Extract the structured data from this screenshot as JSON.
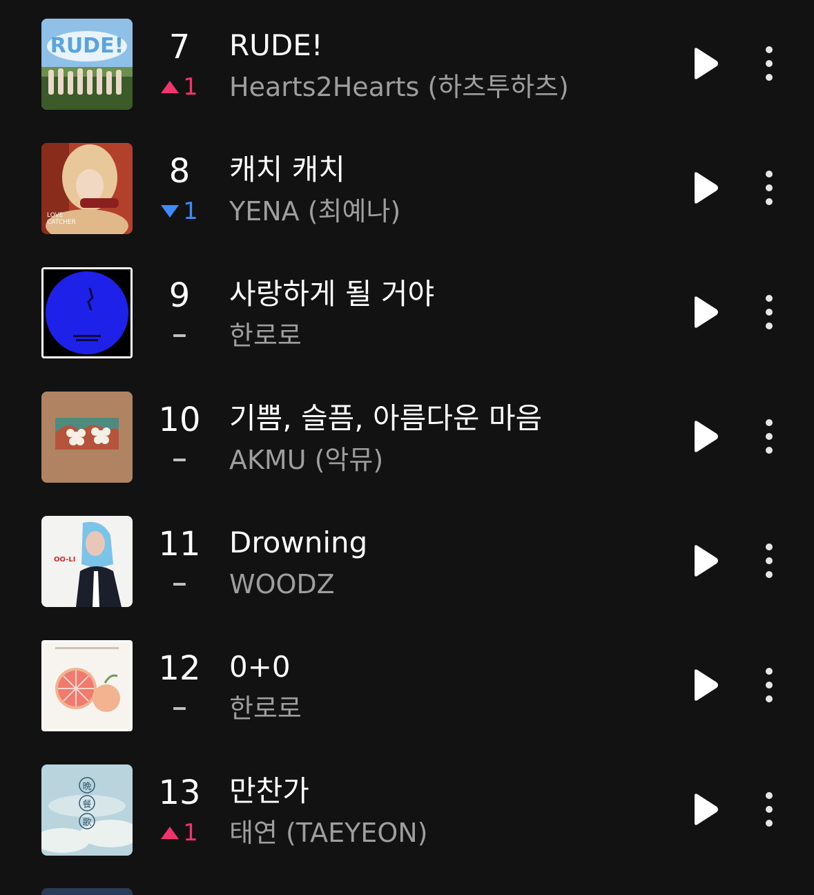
{
  "tracks": [
    {
      "rank": "7",
      "change_dir": "up",
      "change_value": "1",
      "title": "RUDE!",
      "artist": "Hearts2Hearts (하츠투하츠)",
      "art_colors": [
        "#8fc1e8",
        "#3d5a2b",
        "#e8d9c8"
      ],
      "art_text": "RUDE!"
    },
    {
      "rank": "8",
      "change_dir": "down",
      "change_value": "1",
      "title": "캐치 캐치",
      "artist": "YENA (최예나)",
      "art_colors": [
        "#b3402a",
        "#e8c79a",
        "#8c1f1f"
      ],
      "art_text": "LOVE CATCHER"
    },
    {
      "rank": "9",
      "change_dir": "same",
      "change_value": "",
      "title": "사랑하게 될 거야",
      "artist": "한로로",
      "art_colors": [
        "#000000",
        "#1e22e8",
        "#ffffff"
      ],
      "art_text": ""
    },
    {
      "rank": "10",
      "change_dir": "same",
      "change_value": "",
      "title": "기쁨, 슬픔, 아름다운 마음",
      "artist": "AKMU (악뮤)",
      "art_colors": [
        "#b08462",
        "#4f8a7e",
        "#f5f0e6"
      ],
      "art_text": ""
    },
    {
      "rank": "11",
      "change_dir": "same",
      "change_value": "",
      "title": "Drowning",
      "artist": "WOODZ",
      "art_colors": [
        "#f3f3f1",
        "#7cc3ea",
        "#1b1f2c"
      ],
      "art_text": "OO-LI"
    },
    {
      "rank": "12",
      "change_dir": "same",
      "change_value": "",
      "title": "0+0",
      "artist": "한로로",
      "art_colors": [
        "#f7f4ef",
        "#f07a6e",
        "#f2b391"
      ],
      "art_text": ""
    },
    {
      "rank": "13",
      "change_dir": "up",
      "change_value": "1",
      "title": "만찬가",
      "artist": "태연 (TAEYEON)",
      "art_colors": [
        "#b9d4dc",
        "#eaf1ef",
        "#2f5a73"
      ],
      "art_text": "晩 餐 歌"
    }
  ],
  "icons": {
    "play": "play-icon",
    "more": "more-vertical-icon",
    "rank_up": "triangle-up-icon",
    "rank_down": "triangle-down-icon",
    "rank_same": "dash-icon"
  },
  "colors": {
    "background": "#121212",
    "title": "#ffffff",
    "artist": "#9e9e9e",
    "rank_up": "#f2336c",
    "rank_down": "#3d8bff",
    "rank_same": "#bfbfbf"
  }
}
